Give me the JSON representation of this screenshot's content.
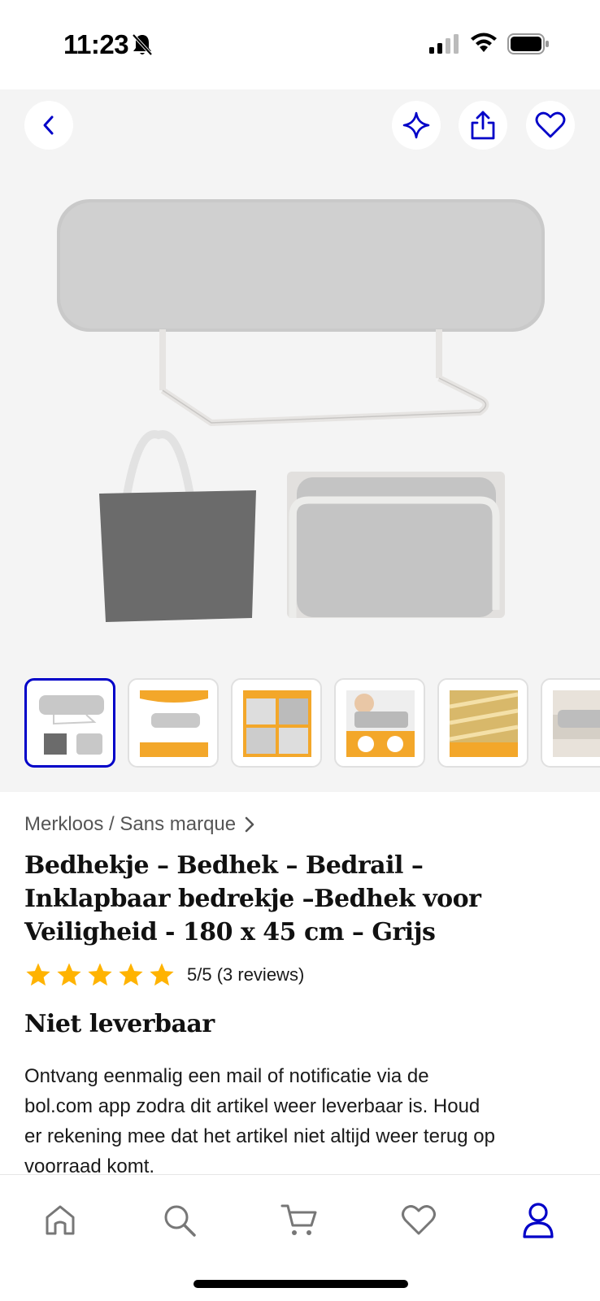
{
  "status_bar": {
    "time": "11:23"
  },
  "header": {
    "icons": [
      "back-icon",
      "sparkle-icon",
      "share-icon",
      "heart-icon"
    ]
  },
  "gallery": {
    "thumbnail_count": 6,
    "selected_index": 0
  },
  "product": {
    "brand": "Merkloos / Sans marque",
    "title_line1": "Bedhekje – Bedhek – Bedrail –",
    "title_line2": "Inklapbaar bedrekje –Bedhek voor",
    "title_line3": "Veiligheid - 180 x 45 cm – Grijs",
    "rating_value": 5,
    "rating_text": "5/5 (3 reviews)",
    "availability": "Niet leverbaar",
    "notify_line1": "Ontvang eenmalig een mail of notificatie via de",
    "notify_line2": "bol.com app zodra dit artikel weer leverbaar is. Houd",
    "notify_line3": "er rekening mee dat het artikel niet altijd weer terug op",
    "notify_line4": "voorraad komt."
  },
  "tab_bar": {
    "items": [
      "home-icon",
      "search-icon",
      "cart-icon",
      "heart-icon",
      "account-icon"
    ],
    "active": "account-icon"
  },
  "colors": {
    "accent": "#0000c8",
    "star": "#ffb300",
    "gallery_bg": "#f4f4f4"
  }
}
